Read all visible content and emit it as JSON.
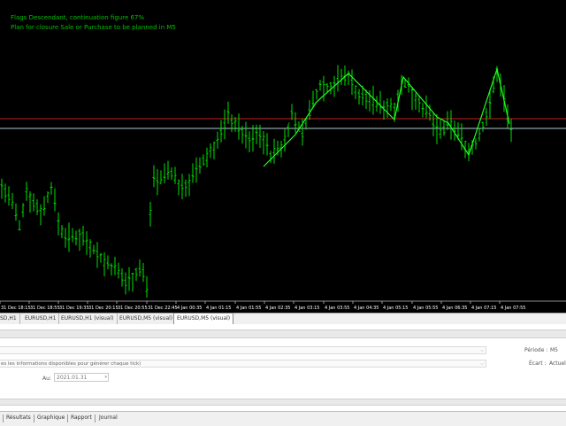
{
  "chart": {
    "annotation_line1": "Flags Descendant, continuation figure 67%",
    "annotation_line2": "Plan for closure Sale or Purchase to be planned in M5",
    "x_labels": [
      "31 Dec 18:15",
      "31 Dec 18:55",
      "31 Dec 19:35",
      "31 Dec 20:15",
      "31 Dec 20:55",
      "31 Dec 22:45",
      "4 Jan 00:35",
      "4 Jan 01:15",
      "4 Jan 01:55",
      "4 Jan 02:35",
      "4 Jan 03:15",
      "4 Jan 03:55",
      "4 Jan 04:35",
      "4 Jan 05:15",
      "4 Jan 05:55",
      "4 Jan 06:35",
      "4 Jan 07:15",
      "4 Jan 07:55"
    ],
    "bar_color": "#00e000",
    "pattern_color": "#22ff22",
    "resistance_color": "#c81e1e",
    "bid_color": "#b0c8d8"
  },
  "tabs": [
    "SD,H1",
    "EURUSD,H1",
    "EURUSD,H1 (visual)",
    "EURUSD,M5 (visual)",
    "EURUSD,M5 (visual)"
  ],
  "settings": {
    "combo1": "",
    "combo2": "es les informations disponibles pour générer chaque tick)",
    "periode_label": "Période :",
    "periode_value": "M5",
    "ecart_label": "Écart :",
    "ecart_value": "Actuel",
    "date_to_label": "Au:",
    "date_to_value": "2021.01.31"
  },
  "bottom_tabs": [
    "Résultats",
    "Graphique",
    "Rapport",
    "Journal"
  ]
}
